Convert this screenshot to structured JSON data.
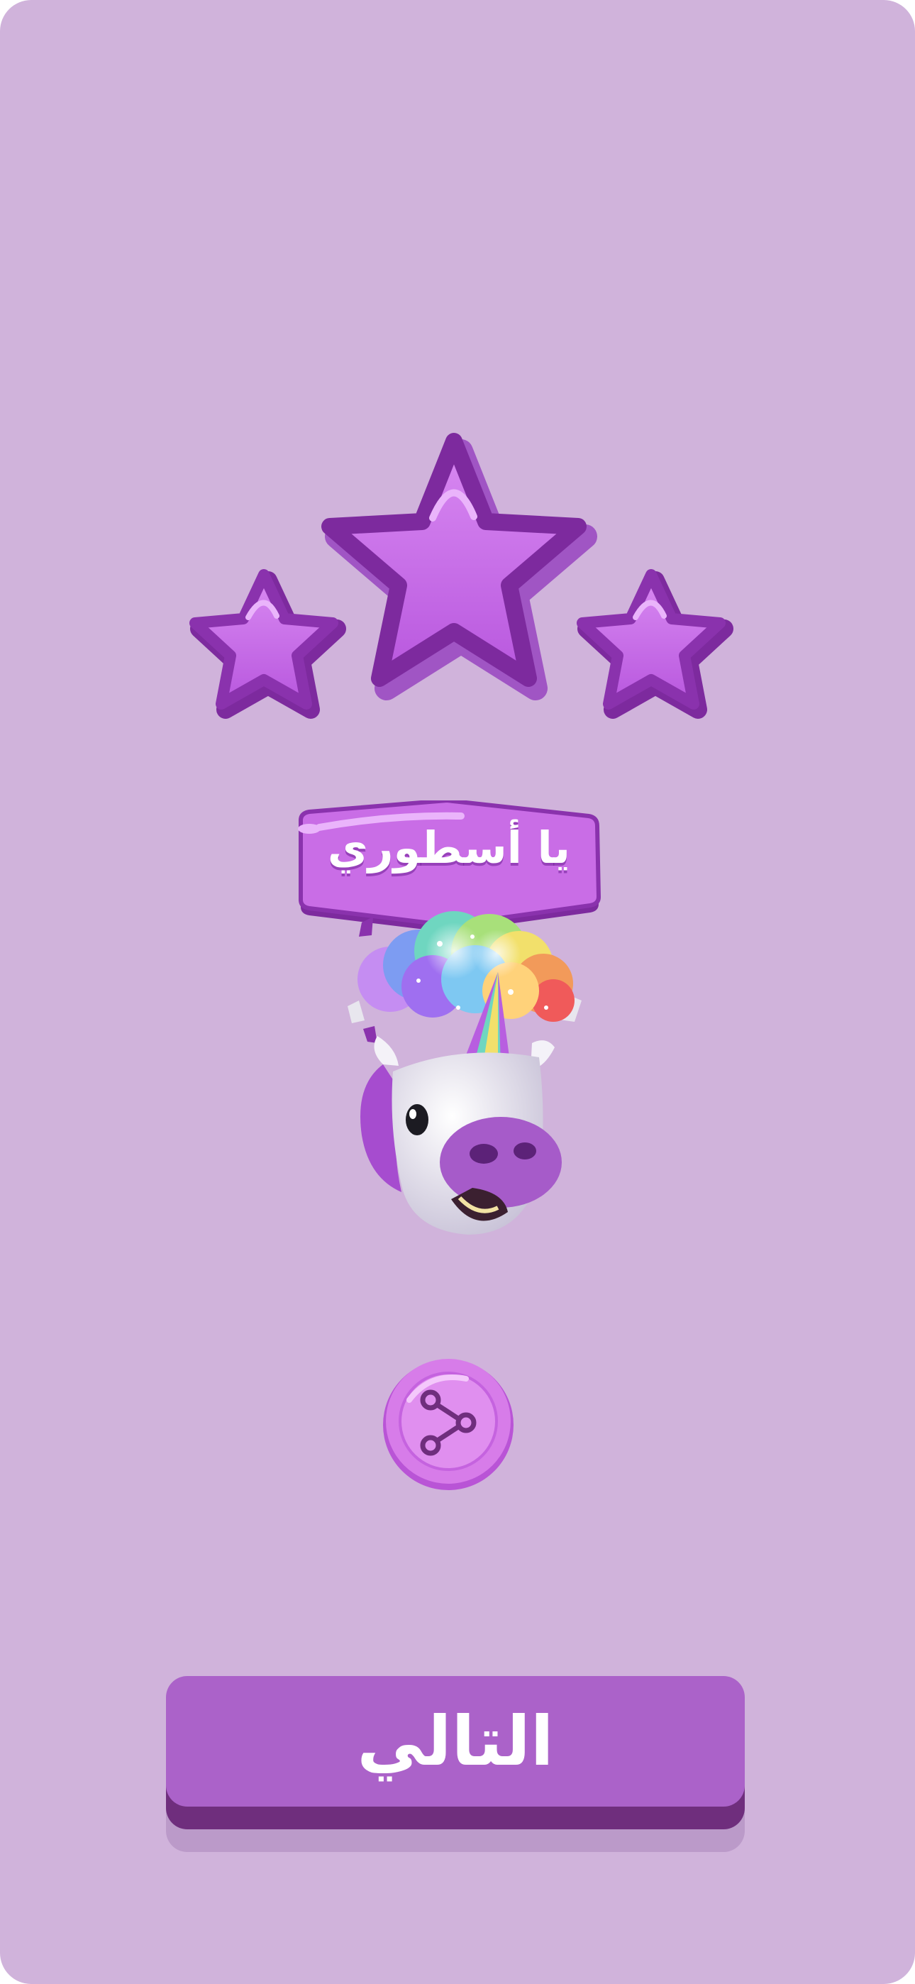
{
  "result": {
    "stars_earned": 3,
    "stars_total": 3,
    "banner_text": "يا أسطوري"
  },
  "mascot": {
    "icon": "unicorn-mascot-icon"
  },
  "share": {
    "icon": "share-icon"
  },
  "next_button": {
    "label": "التالي"
  },
  "colors": {
    "background": "#d0b3db",
    "star_fill": "#c56ae8",
    "star_outline": "#7d2a9e",
    "button_face": "#ab62c9",
    "button_base": "#6f2e7d",
    "share_button": "#d77ce9"
  }
}
